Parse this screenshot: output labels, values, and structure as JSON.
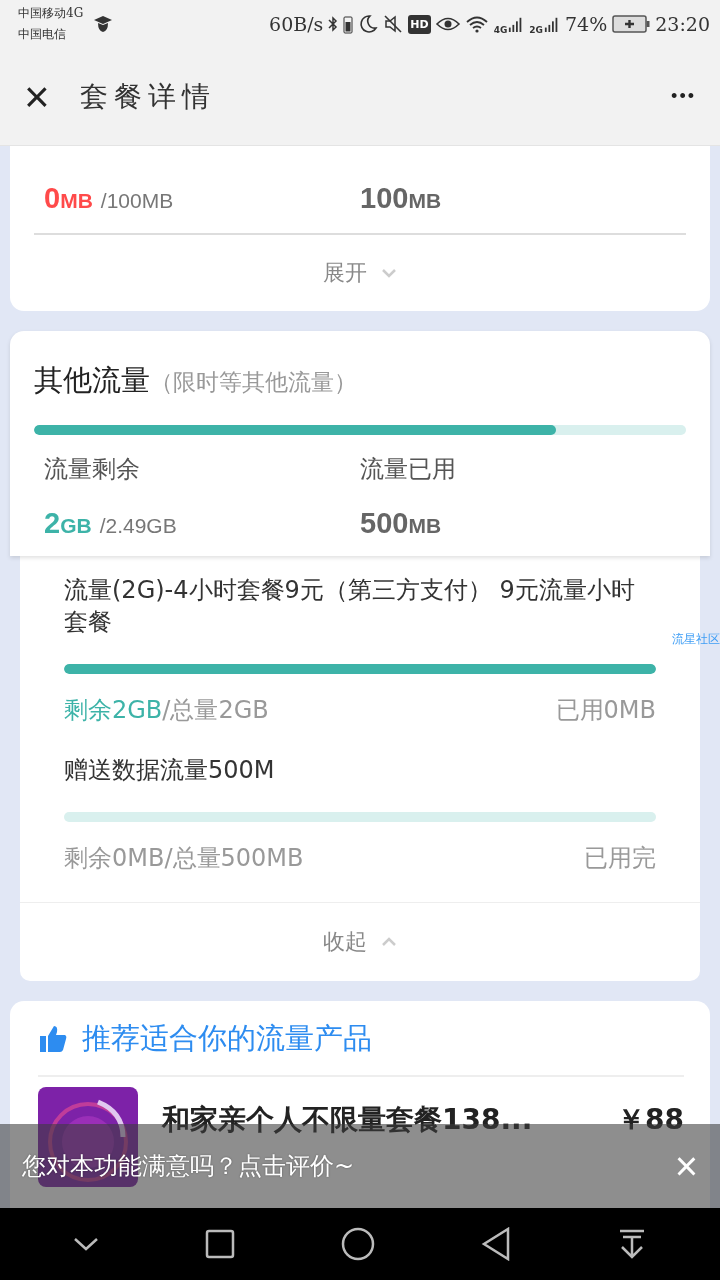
{
  "status_bar": {
    "carriers": [
      "中国移动4G",
      "中国电信"
    ],
    "speed": "60B/s",
    "hd": "HD",
    "networks": [
      "4G",
      "2G"
    ],
    "battery": "74%",
    "time": "23:20"
  },
  "header": {
    "close": "×",
    "title": "套餐详情",
    "more": "•••"
  },
  "main_card": {
    "remaining": {
      "amount": "0",
      "unit": "MB",
      "total": "/100MB",
      "color": "#ff4a4a"
    },
    "used": {
      "amount": "100",
      "unit": "MB"
    },
    "toggle": "展开",
    "expanded": false
  },
  "other_card": {
    "title": "其他流量",
    "subtitle": "（限时等其他流量）",
    "level": 0.8,
    "remaining_label": "流量剩余",
    "used_label": "流量已用",
    "remaining": {
      "amount": "2",
      "unit": "GB",
      "total": "/2.49GB",
      "color": "#3db3a8"
    },
    "used": {
      "amount": "500",
      "unit": "MB"
    },
    "toggle": "收起",
    "expanded": true,
    "items": [
      {
        "name": "流量(2G)-4小时套餐9元（第三方支付） 9元流量小时套餐",
        "level": 1,
        "remaining": "剩余2GB",
        "total": "/总量2GB",
        "highlighted": true,
        "used": "已用0MB"
      },
      {
        "name": "赠送数据流量500M",
        "level": 0,
        "remaining": "剩余0MB",
        "total": "/总量500MB",
        "highlighted": false,
        "used": "已用完"
      }
    ]
  },
  "floating_link": "流星社区",
  "recommend": {
    "title": "推荐适合你的流量产品",
    "product": {
      "name": "和家亲个人不限量套餐138...",
      "price": "￥88"
    }
  },
  "toast": {
    "text": "您对本功能满意吗？点击评价~",
    "close": "×"
  }
}
